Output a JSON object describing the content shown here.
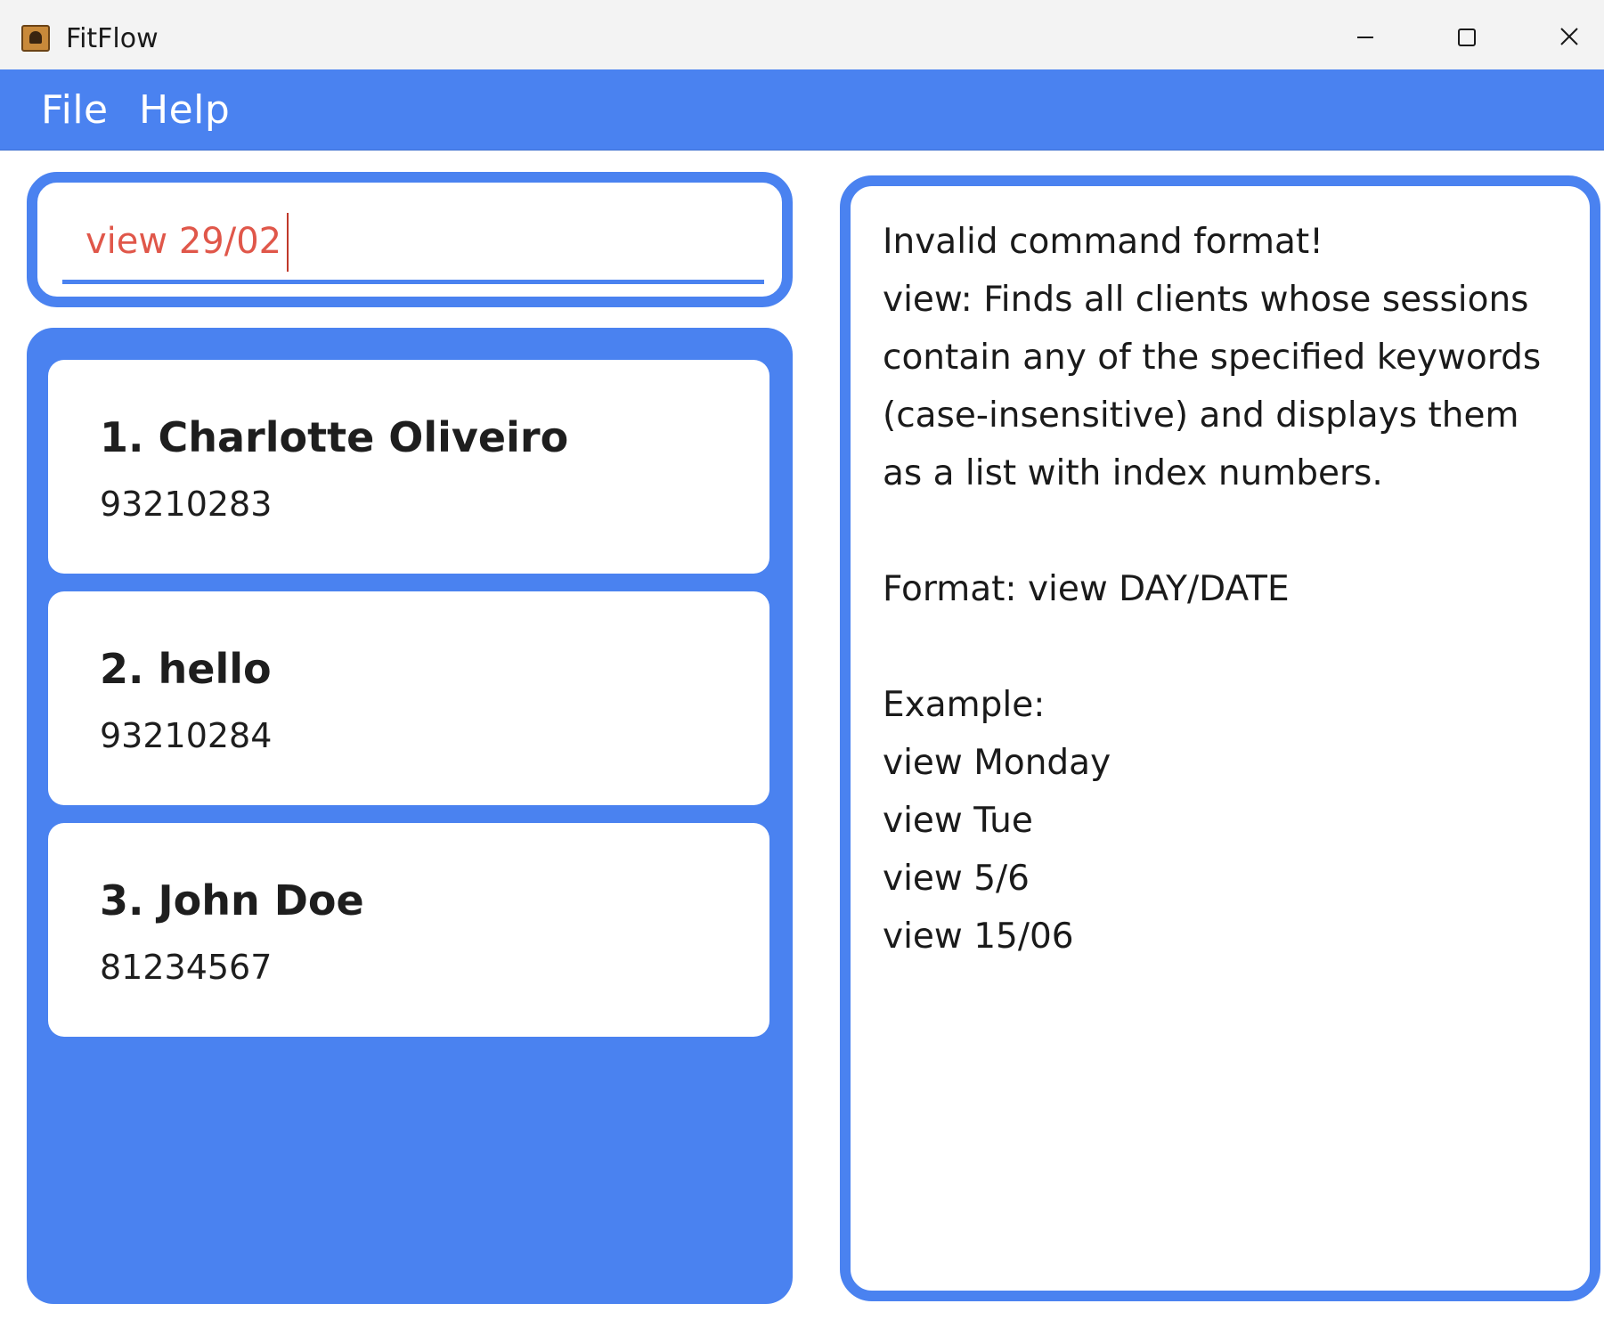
{
  "window": {
    "title": "FitFlow"
  },
  "menu": {
    "file": "File",
    "help": "Help"
  },
  "command": {
    "value": "view 29/02"
  },
  "clients": [
    {
      "name": "1. Charlotte Oliveiro",
      "phone": "93210283"
    },
    {
      "name": "2. hello",
      "phone": "93210284"
    },
    {
      "name": "3. John Doe",
      "phone": "81234567"
    }
  ],
  "result": {
    "text": "Invalid command format!\nview: Finds all clients whose sessions contain any of the specified keywords (case-insensitive) and displays them as a list with index numbers.\n\nFormat: view DAY/DATE\n\nExample:\nview Monday\nview Tue\nview 5/6\nview 15/06"
  },
  "colors": {
    "accent": "#4a82f0",
    "command_text": "#e0574a"
  },
  "icons": {
    "app": "app-icon",
    "minimize": "minimize-icon",
    "maximize": "maximize-icon",
    "close": "close-icon"
  }
}
